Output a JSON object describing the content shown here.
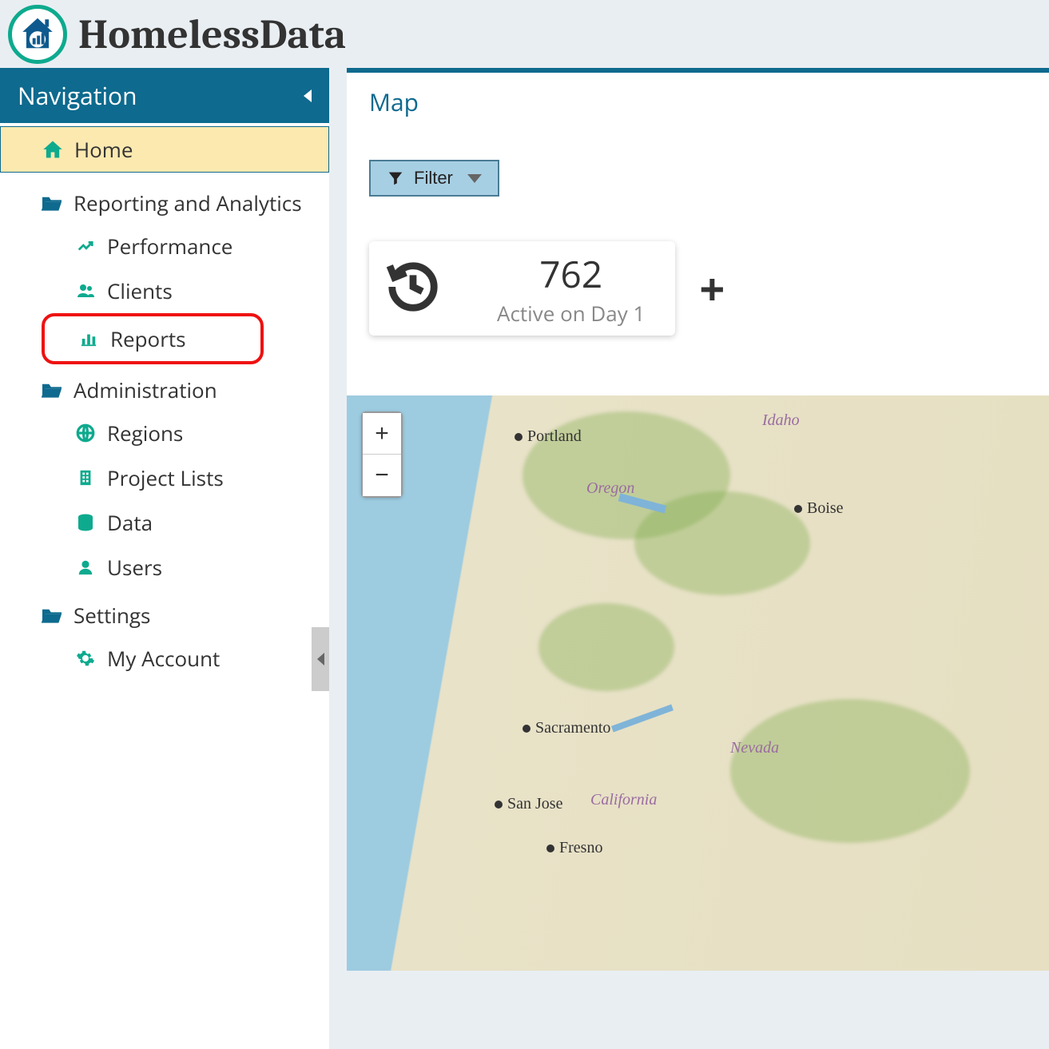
{
  "brand": "HomelessData",
  "sidebar": {
    "title": "Navigation",
    "home": "Home",
    "sections": [
      {
        "label": "Reporting and Analytics",
        "items": [
          "Performance",
          "Clients",
          "Reports"
        ]
      },
      {
        "label": "Administration",
        "items": [
          "Regions",
          "Project Lists",
          "Data",
          "Users"
        ]
      },
      {
        "label": "Settings",
        "items": [
          "My Account"
        ]
      }
    ]
  },
  "main": {
    "panel_title": "Map",
    "filter_label": "Filter",
    "stat": {
      "value": "762",
      "label": "Active on Day 1"
    },
    "map": {
      "cities": [
        "Portland",
        "Boise",
        "Sacramento",
        "San Jose",
        "Fresno"
      ],
      "states": [
        "Idaho",
        "Oregon",
        "Nevada",
        "California"
      ]
    }
  }
}
